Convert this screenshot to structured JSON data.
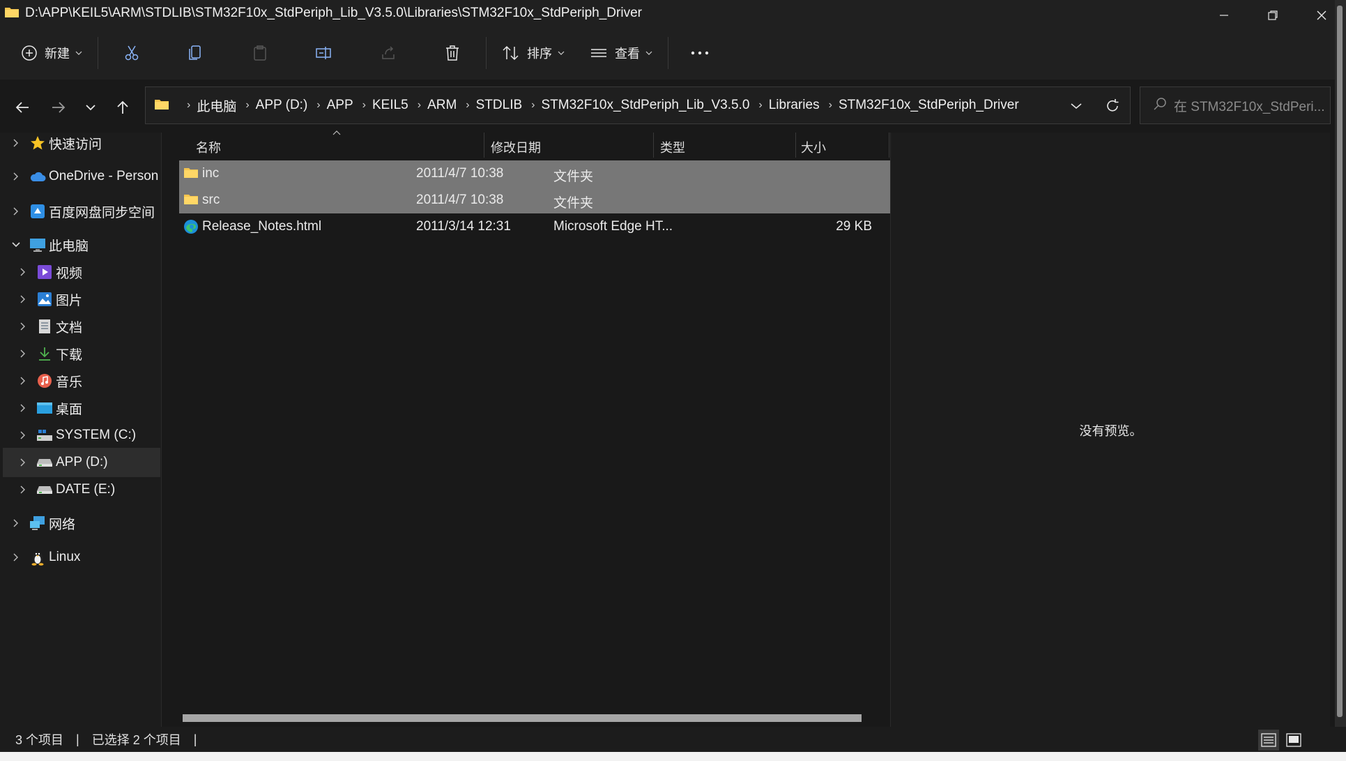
{
  "window": {
    "title": "D:\\APP\\KEIL5\\ARM\\STDLIB\\STM32F10x_StdPeriph_Lib_V3.5.0\\Libraries\\STM32F10x_StdPeriph_Driver"
  },
  "toolbar": {
    "new_label": "新建",
    "sort_label": "排序",
    "view_label": "查看"
  },
  "address": {
    "crumbs": [
      "此电脑",
      "APP (D:)",
      "APP",
      "KEIL5",
      "ARM",
      "STDLIB",
      "STM32F10x_StdPeriph_Lib_V3.5.0",
      "Libraries",
      "STM32F10x_StdPeriph_Driver"
    ]
  },
  "search": {
    "placeholder": "在 STM32F10x_StdPeri..."
  },
  "sidebar": {
    "items": [
      {
        "label": "快速访问",
        "icon": "star-icon"
      },
      {
        "label": "OneDrive - Person",
        "icon": "cloud-icon"
      },
      {
        "label": "百度网盘同步空间",
        "icon": "baidu-drive-icon"
      },
      {
        "label": "此电脑",
        "icon": "computer-icon"
      },
      {
        "label": "视频",
        "icon": "video-icon"
      },
      {
        "label": "图片",
        "icon": "pictures-icon"
      },
      {
        "label": "文档",
        "icon": "documents-icon"
      },
      {
        "label": "下载",
        "icon": "download-icon"
      },
      {
        "label": "音乐",
        "icon": "music-icon"
      },
      {
        "label": "桌面",
        "icon": "desktop-icon"
      },
      {
        "label": "SYSTEM (C:)",
        "icon": "system-drive-icon"
      },
      {
        "label": "APP (D:)",
        "icon": "drive-icon"
      },
      {
        "label": "DATE (E:)",
        "icon": "drive-icon"
      },
      {
        "label": "网络",
        "icon": "network-icon"
      },
      {
        "label": "Linux",
        "icon": "linux-penguin-icon"
      }
    ]
  },
  "columns": {
    "name": "名称",
    "modified": "修改日期",
    "type": "类型",
    "size": "大小"
  },
  "files": [
    {
      "name": "inc",
      "modified": "2011/4/7 10:38",
      "type": "文件夹",
      "size": "",
      "selected": true,
      "icon": "folder-icon"
    },
    {
      "name": "src",
      "modified": "2011/4/7 10:38",
      "type": "文件夹",
      "size": "",
      "selected": true,
      "icon": "folder-icon"
    },
    {
      "name": "Release_Notes.html",
      "modified": "2011/3/14 12:31",
      "type": "Microsoft Edge HT...",
      "size": "29 KB",
      "selected": false,
      "icon": "edge-icon"
    }
  ],
  "preview": {
    "text": "没有预览。"
  },
  "status": {
    "count": "3 个项目",
    "selected": "已选择 2 个项目",
    "sep": "|"
  }
}
